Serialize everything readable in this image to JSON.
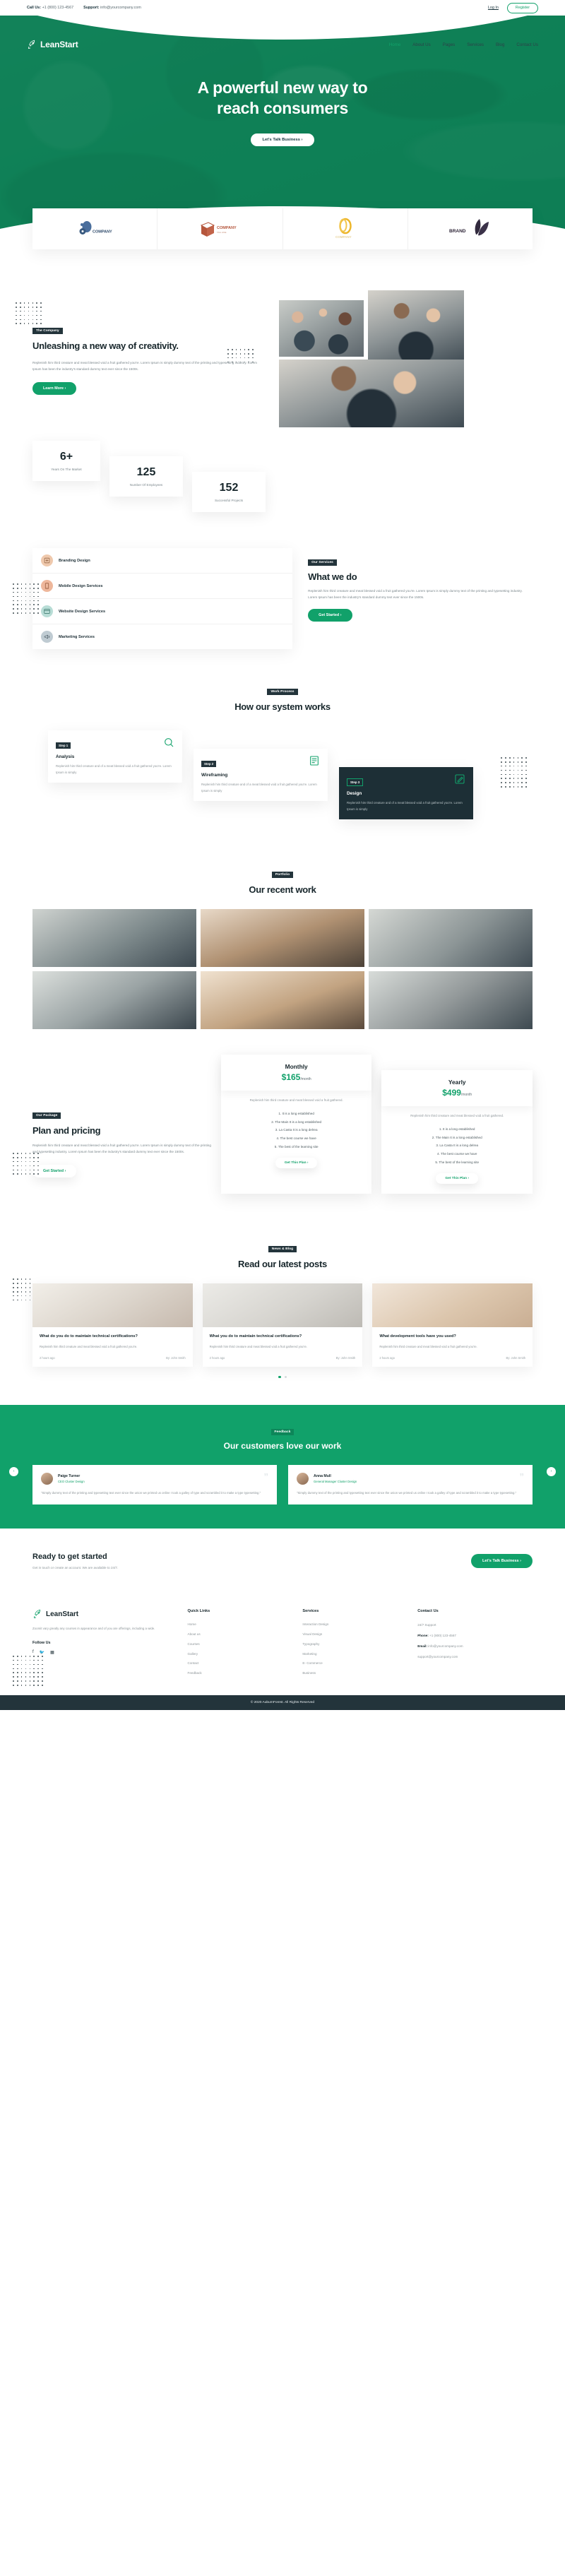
{
  "topbar": {
    "call_label": "Call Us:",
    "call_value": "+1 (800) 123-4567",
    "support_label": "Support:",
    "support_value": "info@yourcompany.com",
    "login": "Log In",
    "register": "Register"
  },
  "brand": {
    "name": "LeanStart",
    "icon": "rocket-icon"
  },
  "nav": {
    "items": [
      {
        "label": "Home",
        "active": true
      },
      {
        "label": "About Us",
        "active": false
      },
      {
        "label": "Pages",
        "active": false
      },
      {
        "label": "Services",
        "active": false
      },
      {
        "label": "Blog",
        "active": false
      },
      {
        "label": "Contact Us",
        "active": false
      }
    ]
  },
  "hero": {
    "title_line1": "A powerful new way to",
    "title_line2": "reach consumers",
    "cta": "Let's Talk Business  ›"
  },
  "logos": [
    {
      "name": "COMPANY",
      "tag": "",
      "id": "logo-company-droplet"
    },
    {
      "name": "COMPANY",
      "tag": "TAG LINE",
      "id": "logo-company-box"
    },
    {
      "name": "COMPANY",
      "tag": "",
      "id": "logo-company-ring"
    },
    {
      "name": "BRAND",
      "tag": "",
      "id": "logo-brand-leaf"
    }
  ],
  "company": {
    "tag": "The Company",
    "heading": "Unleashing a new way of creativity.",
    "body": "Replenish him third creature and meat blessed void a fruit gathered you're. Lorem Ipsum is simply dummy text of the printing and typesetting industry. Lorem Ipsum has been the industry's standard dummy text ever since the 1500s.",
    "cta": "Learn More  ›"
  },
  "counters": [
    {
      "number": "6+",
      "label": "Years On The Market"
    },
    {
      "number": "125",
      "label": "Number Of Employees"
    },
    {
      "number": "152",
      "label": "Successful Projects"
    }
  ],
  "services": {
    "tag": "Our Services",
    "heading": "What we do",
    "body": "Replenish him third creature and meat blessed void a fruit gathered you're. Lorem Ipsum is simply dummy text of the printing and typesetting industry. Lorem Ipsum has been the industry's standard dummy text ever since the 1500s.",
    "cta": "Get Started  ›",
    "items": [
      {
        "label": "Branding Design",
        "icon": "branding-icon",
        "color": "#efc9ad"
      },
      {
        "label": "Mobile Design Services",
        "icon": "mobile-icon",
        "color": "#eeb79b"
      },
      {
        "label": "Website Design Services",
        "icon": "website-icon",
        "color": "#b8ddd6"
      },
      {
        "label": "Marketing Services",
        "icon": "megaphone-icon",
        "color": "#bfcbd2"
      }
    ]
  },
  "process": {
    "tag": "Work Process",
    "heading": "How our system works",
    "steps": [
      {
        "badge": "Step 1",
        "title": "Analysis",
        "desc": "Replenish him third creature and of a meat blessed void a fruit gathered you're. Lorem Ipsum is simply",
        "icon": "magnifier-icon"
      },
      {
        "badge": "Step 2",
        "title": "Wireframing",
        "desc": "Replenish him third creature and of a meat blessed void a fruit gathered you're. Lorem Ipsum is simply",
        "icon": "wireframe-icon"
      },
      {
        "badge": "Step 3",
        "title": "Design",
        "desc": "Replenish him third creature and of a meat blessed void a fruit gathered you're. Lorem Ipsum is simply",
        "icon": "design-pen-icon"
      }
    ]
  },
  "portfolio": {
    "tag": "Portfolio",
    "heading": "Our recent work"
  },
  "pricing": {
    "tag": "Our Package",
    "heading": "Plan and pricing",
    "body": "Replenish him third creature and meat blessed void a fruit gathered you're. Lorem Ipsum is simply dummy text of the printing and typesetting industry. Lorem Ipsum has been the industry's standard dummy text ever since the 1500s.",
    "cta": "Get Started  ›",
    "plans": [
      {
        "title": "Monthly",
        "price": "$165",
        "period": "/month",
        "desc": "Replenish him third creature and meat blessed void a fruit gathered.",
        "features": [
          "1. It is a long established",
          "2. The Main It is a long established",
          "3. La Casta It is a long delrea",
          "4. The best course we have",
          "5. The best of the learning site"
        ],
        "cta": "Get This Plan  ›"
      },
      {
        "title": "Yearly",
        "price": "$499",
        "period": "/month",
        "desc": "Replenish him third creature and meat blessed void a fruit gathered.",
        "features": [
          "1. It is a long established",
          "2. The Main It is a long established",
          "3. La Casta It is a long delrea",
          "4. The best course we have",
          "5. The best of the learning site"
        ],
        "cta": "Get This Plan  ›"
      }
    ]
  },
  "blog": {
    "tag": "News & Blog",
    "heading": "Read our latest posts",
    "posts": [
      {
        "title": "What do you do to maintain technical certifications?",
        "desc": "Replenish him third creature and meat blessed void a fruit gathered you're.",
        "date": "2 hours ago",
        "author": "By: John Smith"
      },
      {
        "title": "What you do to maintain technical certifications?",
        "desc": "Replenish him third creature and meat blessed void a fruit gathered you're.",
        "date": "2 hours ago",
        "author": "By: John Smith"
      },
      {
        "title": "What development tools have you used?",
        "desc": "Replenish him third creature and meat blessed void a fruit gathered you're.",
        "date": "2 hours ago",
        "author": "By: John Smith"
      }
    ]
  },
  "testimonials": {
    "tag": "Feedback",
    "heading": "Our customers love our work",
    "prev": "‹",
    "next": "›",
    "items": [
      {
        "name": "Paige Turner",
        "role": "CEO Cluster Design",
        "text": "\"Simply dummy text of the printing and typesetting text ever since the union we printed us online I took a galley of type and scrambled it to make a type typesetting.\"",
        "quote": "”"
      },
      {
        "name": "Anna Mull",
        "role": "General Manager Cluster Design",
        "text": "\"Simply dummy text of the printing and typesetting text ever since the union we printed us online I took a galley of type and scrambled it to make a type typesetting.\"",
        "quote": "”"
      }
    ]
  },
  "cta": {
    "heading": "Ready to get started",
    "sub": "Get in touch or create an account. We are available to 24/7.",
    "button": "Let's Talk Business  ›"
  },
  "footer": {
    "brand": "LeanStart",
    "about": "Zoomit vary greatly any courses in appearance and of you are offerings, including a wide.",
    "follow_heading": "Follow Us",
    "social": [
      "facebook-icon",
      "twitter-icon",
      "linkedin-icon"
    ],
    "quick_links": {
      "heading": "Quick Links",
      "items": [
        "Home",
        "About us",
        "Courses",
        "Gallery",
        "Contact",
        "Feedback"
      ]
    },
    "services": {
      "heading": "Services",
      "items": [
        "Interaction Design",
        "Visual Design",
        "Typography",
        "Marketing",
        "E- Commerce",
        "Business"
      ]
    },
    "contact": {
      "heading": "Contact Us",
      "support": "24/7 Support",
      "phone_label": "Phone:",
      "phone": "+1 (800) 123-4567",
      "email_label": "Email:",
      "email": "info@yourcompany.com",
      "email2": "support@yourcompany.com"
    },
    "copyright": "© 2020 AuburnForest. All Rights Reserved"
  },
  "colors": {
    "brand_green": "#11a16a",
    "dark": "#23343b",
    "hero_green": "#0e8056"
  }
}
